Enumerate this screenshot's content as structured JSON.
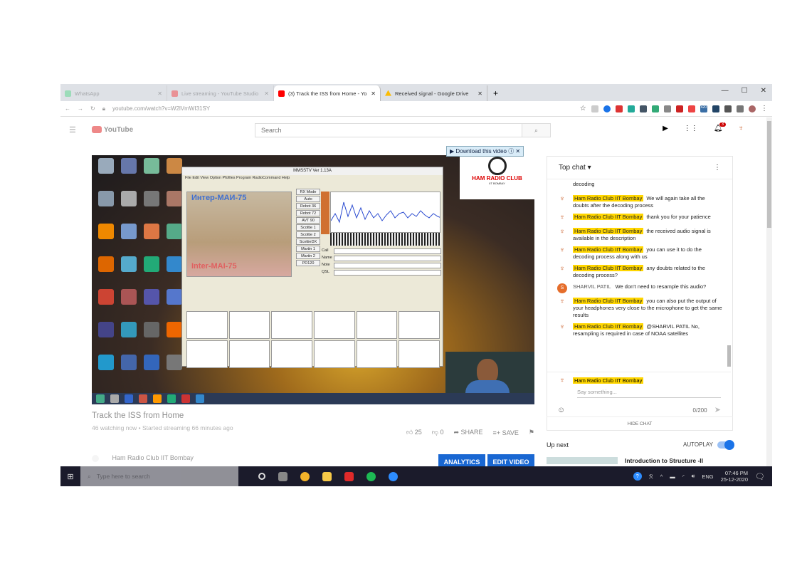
{
  "browser": {
    "tabs": [
      {
        "label": "WhatsApp",
        "icon": "whatsapp-icon",
        "color": "#25d366",
        "faded": true
      },
      {
        "label": "Live streaming - YouTube Studio",
        "icon": "youtube-studio-icon",
        "color": "#ff0000",
        "faded": true
      },
      {
        "label": "(3) Track the ISS from Home - Yo",
        "icon": "youtube-icon",
        "color": "#ff0000",
        "faded": false
      },
      {
        "label": "Received signal - Google Drive",
        "icon": "google-drive-icon",
        "color": "#fbbc04",
        "faded": false
      }
    ],
    "new_tab": "+",
    "url": "youtube.com/watch?v=W2lVmWI31SY",
    "extension_badge": "420"
  },
  "youtube": {
    "logo": "YouTube",
    "search_placeholder": "Search",
    "notification_count": "3"
  },
  "video": {
    "download_label": "Download this video",
    "app_title": "MMSSTV Ver 1.13A",
    "app_menu": "File  Edit  View  Option  Pfofiles  Program  RadioCommand  Help",
    "image_text_top": "Интер-МАИ-75",
    "image_text_bottom": "Inter-MAI-75",
    "rx_mode": [
      "RX Mode",
      "Auto",
      "Robot 36",
      "Robot 72",
      "AVT 90",
      "Scottie 1",
      "Scottie 2",
      "ScottieDX",
      "Martin 1",
      "Martin 2",
      "PD120"
    ],
    "log_fields": [
      "Call",
      "Name",
      "Note",
      "QSL"
    ],
    "ham_logo_name": "HAM RADIO CLUB",
    "ham_logo_sub": "IIT BOMBAY"
  },
  "video_info": {
    "title": "Track the ISS from Home",
    "meta": "46 watching now • Started streaming 66 minutes ago",
    "likes": "25",
    "dislikes": "0",
    "share_label": "SHARE",
    "save_label": "SAVE",
    "channel": "Ham Radio Club IIT Bombay",
    "analytics_label": "ANALYTICS",
    "edit_label": "EDIT VIDEO"
  },
  "chat": {
    "header": "Top chat",
    "messages": [
      {
        "author": "",
        "text": "decoding"
      },
      {
        "author": "Ham Radio Club IIT Bombay",
        "text": "We will again take all the doubts after the decoding process"
      },
      {
        "author": "Ham Radio Club IIT Bombay",
        "text": "thank you for your patience"
      },
      {
        "author": "Ham Radio Club IIT Bombay",
        "text": "the received audio signal is available in the description"
      },
      {
        "author": "Ham Radio Club IIT Bombay",
        "text": "you can use it to do the decoding process along with us"
      },
      {
        "author": "Ham Radio Club IIT Bombay",
        "text": "any doubts related to the decoding process?"
      },
      {
        "author": "SHARVIL PATIL",
        "text": "We don't need to resample this audio?"
      },
      {
        "author": "Ham Radio Club IIT Bombay",
        "text": "you can also put the output of your headphones very close to the microphone to get the same results"
      },
      {
        "author": "Ham Radio Club IIT Bombay",
        "text": "@SHARVIL PATIL No, resampling is required in case of NOAA satellites"
      }
    ],
    "input_author": "Ham Radio Club IIT Bombay",
    "input_placeholder": "Say something...",
    "char_count": "0/200",
    "hide_label": "HIDE CHAT"
  },
  "upnext": {
    "label": "Up next",
    "autoplay_label": "AUTOPLAY",
    "next_title": "Introduction to Structure -II"
  },
  "taskbar": {
    "search_placeholder": "Type here to search",
    "language": "ENG",
    "time": "07:46 PM",
    "date": "25-12-2020"
  }
}
